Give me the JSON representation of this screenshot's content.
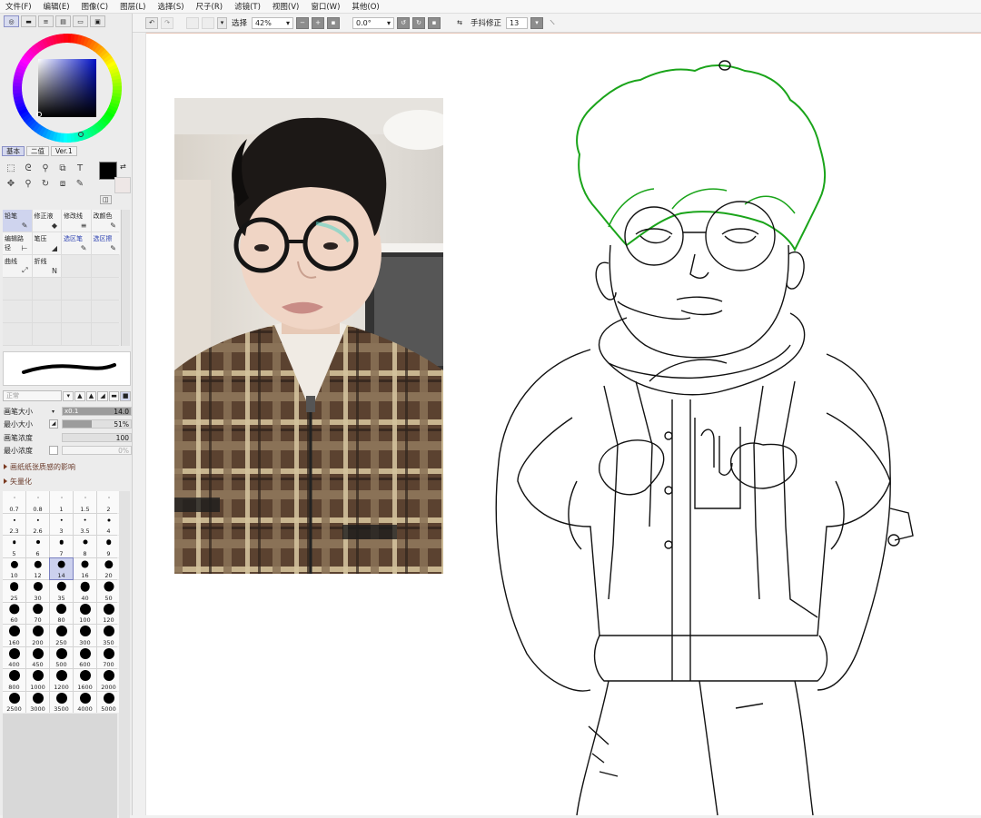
{
  "menu": [
    "文件(F)",
    "编辑(E)",
    "图像(C)",
    "图层(L)",
    "选择(S)",
    "尺子(R)",
    "滤镜(T)",
    "视图(V)",
    "窗口(W)",
    "其他(O)"
  ],
  "colorModes": {
    "basic": "基本",
    "sv": "二值",
    "ver": "Ver.1"
  },
  "brushes": [
    {
      "label": "铅笔",
      "icon": "✎",
      "on": true
    },
    {
      "label": "修正液",
      "icon": "◆"
    },
    {
      "label": "修改线",
      "icon": "≡"
    },
    {
      "label": "改颜色",
      "icon": "✎"
    },
    {
      "label": "编辑路径",
      "icon": "⊢"
    },
    {
      "label": "笔压",
      "icon": "◢"
    },
    {
      "label": "选区笔",
      "icon": "✎",
      "blue": true
    },
    {
      "label": "选区擦",
      "icon": "✎",
      "blue": true
    },
    {
      "label": "曲线",
      "icon": "⤢"
    },
    {
      "label": "折线",
      "icon": "N"
    }
  ],
  "blendMode": "正常",
  "params": {
    "sizeLabel": "画笔大小",
    "sizeMult": "x0.1",
    "sizeVal": "14.0",
    "minLabel": "最小大小",
    "minVal": "51%",
    "densLabel": "画笔浓度",
    "densVal": "100",
    "minDensLabel": "最小浓度",
    "minDensVal": "0%"
  },
  "sections": {
    "paper": "画纸纸张质感的影响",
    "vector": "矢量化"
  },
  "sizes": [
    "0.7",
    "0.8",
    "1",
    "1.5",
    "2",
    "2.3",
    "2.6",
    "3",
    "3.5",
    "4",
    "5",
    "6",
    "7",
    "8",
    "9",
    "10",
    "12",
    "14",
    "16",
    "20",
    "25",
    "30",
    "35",
    "40",
    "50",
    "60",
    "70",
    "80",
    "100",
    "120",
    "160",
    "200",
    "250",
    "300",
    "350",
    "400",
    "450",
    "500",
    "600",
    "700",
    "800",
    "1000",
    "1200",
    "1600",
    "2000",
    "2500",
    "3000",
    "3500",
    "4000",
    "5000"
  ],
  "selectedSize": "14",
  "toolbar": {
    "selectLabel": "选择",
    "zoom": "42%",
    "angle": "0.0°",
    "stabLabel": "手抖修正",
    "stabVal": "13"
  }
}
